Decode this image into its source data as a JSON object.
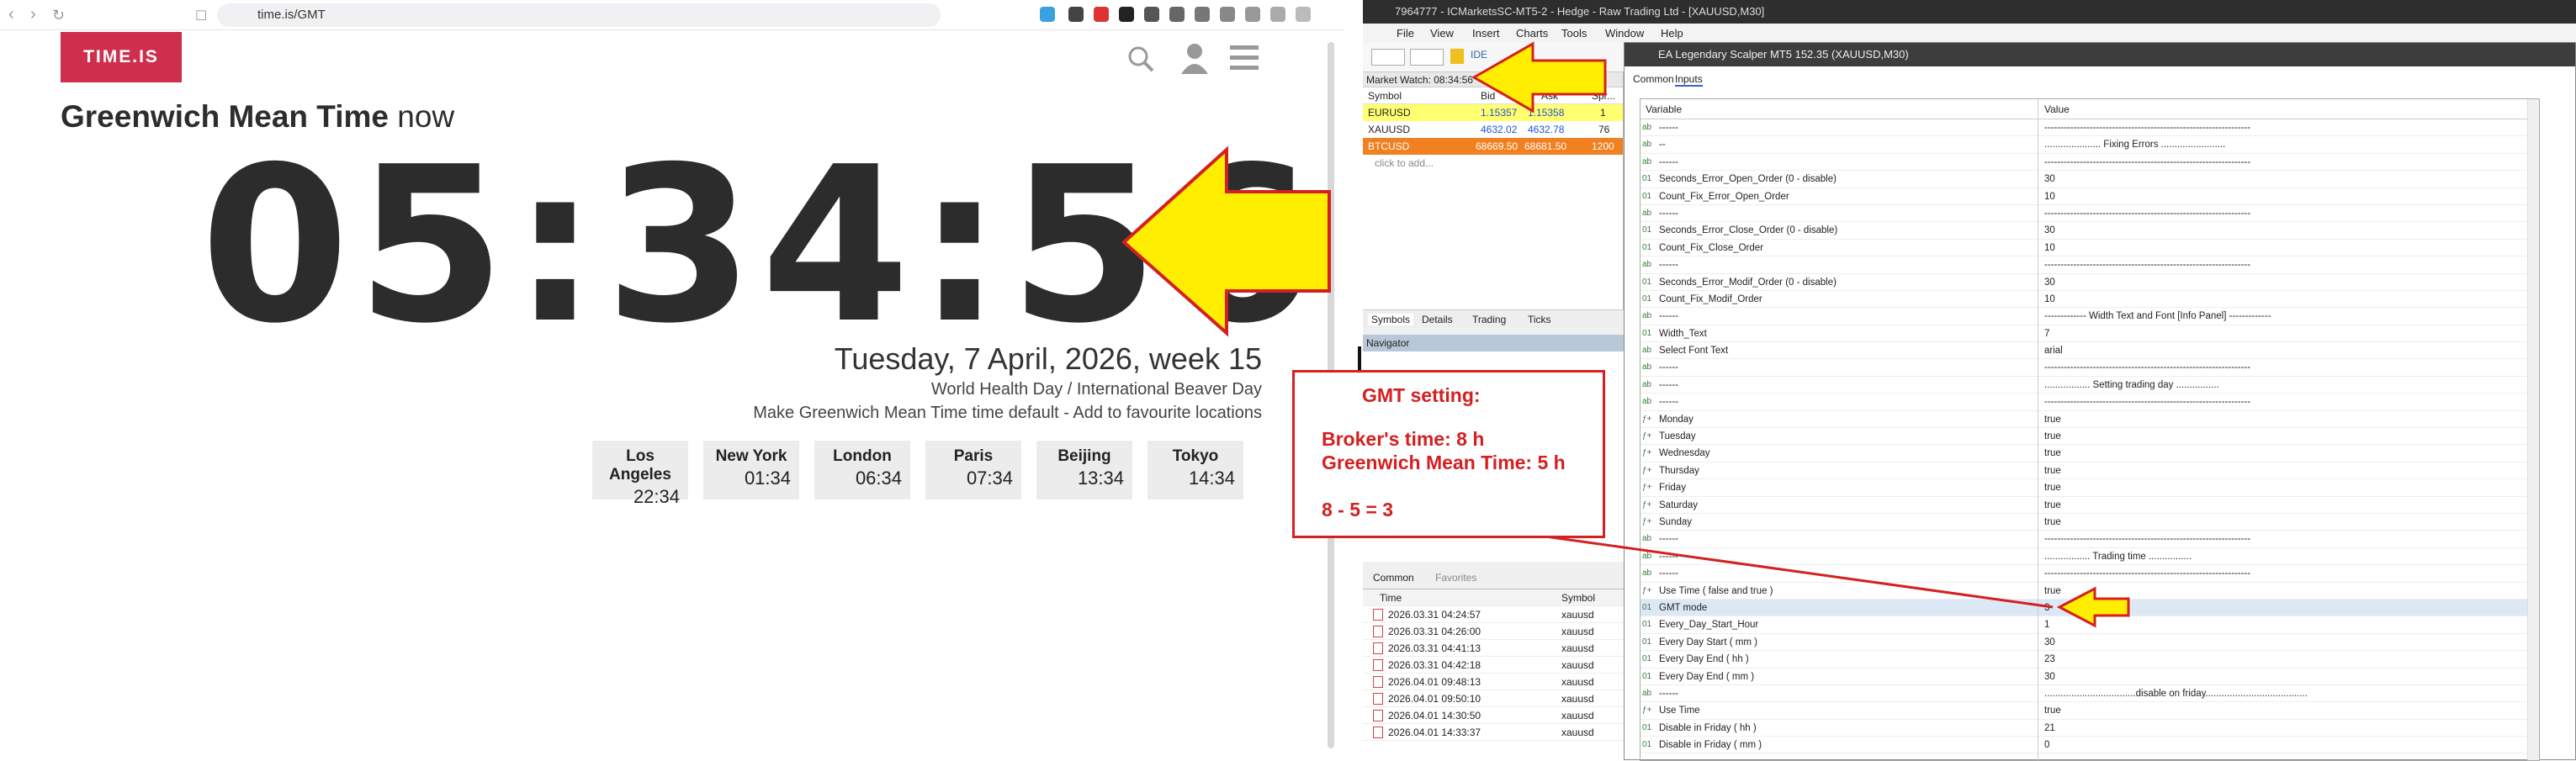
{
  "browser": {
    "url": "time.is/GMT",
    "logo": "TIME.IS",
    "title_bold": "Greenwich Mean Time",
    "title_light": " now",
    "clock": "05:34:56",
    "date": "Tuesday, 7 April, 2026, week 15",
    "holiday": "World Health Day / International Beaver Day",
    "make_default": "Make Greenwich Mean Time time default - Add to favourite locations",
    "cities": [
      {
        "name": "Los Angeles",
        "time": "22:34"
      },
      {
        "name": "New York",
        "time": "01:34"
      },
      {
        "name": "London",
        "time": "06:34"
      },
      {
        "name": "Paris",
        "time": "07:34"
      },
      {
        "name": "Beijing",
        "time": "13:34"
      },
      {
        "name": "Tokyo",
        "time": "14:34"
      }
    ]
  },
  "mt5": {
    "window_title": "7964777 - ICMarketsSC-MT5-2 - Hedge - Raw Trading Ltd - [XAUUSD,M30]",
    "menu": [
      "File",
      "View",
      "Insert",
      "Charts",
      "Tools",
      "Window",
      "Help"
    ],
    "market_watch": {
      "header": "Market Watch: 08:34:56",
      "columns": [
        "Symbol",
        "Bid",
        "Ask",
        "Spr..."
      ],
      "rows": [
        {
          "symbol": "EURUSD",
          "bid": "1.15357",
          "ask": "1.15358",
          "spread": "1"
        },
        {
          "symbol": "XAUUSD",
          "bid": "4632.02",
          "ask": "4632.78",
          "spread": "76"
        },
        {
          "symbol": "BTCUSD",
          "bid": "68669.50",
          "ask": "68681.50",
          "spread": "1200"
        }
      ],
      "add_label": "click to add...",
      "tabs": [
        "Symbols",
        "Details",
        "Trading",
        "Ticks"
      ]
    },
    "navigator": "Navigator",
    "bottom_tabs": [
      "Common",
      "Favorites"
    ],
    "history": {
      "columns": [
        "Time",
        "Symbol"
      ],
      "rows": [
        {
          "time": "2026.03.31 04:24:57",
          "symbol": "xauusd"
        },
        {
          "time": "2026.03.31 04:26:00",
          "symbol": "xauusd"
        },
        {
          "time": "2026.03.31 04:41:13",
          "symbol": "xauusd"
        },
        {
          "time": "2026.03.31 04:42:18",
          "symbol": "xauusd"
        },
        {
          "time": "2026.04.01 09:48:13",
          "symbol": "xauusd"
        },
        {
          "time": "2026.04.01 09:50:10",
          "symbol": "xauusd"
        },
        {
          "time": "2026.04.01 14:30:50",
          "symbol": "xauusd"
        },
        {
          "time": "2026.04.01 14:33:37",
          "symbol": "xauusd"
        }
      ]
    },
    "dialog": {
      "title": "EA Legendary Scalper MT5 152.35 (XAUUSD,M30)",
      "tabs": [
        "Common",
        "Inputs"
      ],
      "col_variable": "Variable",
      "col_value": "Value",
      "rows": [
        {
          "icon": "ab",
          "name": "------",
          "value": "----------------------------------------------------------------"
        },
        {
          "icon": "ab",
          "name": "--",
          "value": "..................... Fixing Errors ........................"
        },
        {
          "icon": "ab",
          "name": "------",
          "value": "----------------------------------------------------------------"
        },
        {
          "icon": "01",
          "name": "Seconds_Error_Open_Order (0 - disable)",
          "value": "30"
        },
        {
          "icon": "01",
          "name": "Count_Fix_Error_Open_Order",
          "value": "10"
        },
        {
          "icon": "ab",
          "name": "------",
          "value": "----------------------------------------------------------------"
        },
        {
          "icon": "01",
          "name": "Seconds_Error_Close_Order (0 - disable)",
          "value": "30"
        },
        {
          "icon": "01",
          "name": "Count_Fix_Close_Order",
          "value": "10"
        },
        {
          "icon": "ab",
          "name": "------",
          "value": "----------------------------------------------------------------"
        },
        {
          "icon": "01",
          "name": "Seconds_Error_Modif_Order (0 - disable)",
          "value": "30"
        },
        {
          "icon": "01",
          "name": "Count_Fix_Modif_Order",
          "value": "10"
        },
        {
          "icon": "ab",
          "name": "------",
          "value": "------------- Width Text and Font [Info Panel] -------------"
        },
        {
          "icon": "01",
          "name": "Width_Text",
          "value": "7"
        },
        {
          "icon": "ab",
          "name": "Select Font Text",
          "value": "arial"
        },
        {
          "icon": "ab",
          "name": "------",
          "value": "----------------------------------------------------------------"
        },
        {
          "icon": "ab",
          "name": "------",
          "value": "................. Setting trading day ................"
        },
        {
          "icon": "ab",
          "name": "------",
          "value": "----------------------------------------------------------------"
        },
        {
          "icon": "tf",
          "name": "Monday",
          "value": "true"
        },
        {
          "icon": "tf",
          "name": "Tuesday",
          "value": "true"
        },
        {
          "icon": "tf",
          "name": "Wednesday",
          "value": "true"
        },
        {
          "icon": "tf",
          "name": "Thursday",
          "value": "true"
        },
        {
          "icon": "tf",
          "name": "Friday",
          "value": "true"
        },
        {
          "icon": "tf",
          "name": "Saturday",
          "value": "true"
        },
        {
          "icon": "tf",
          "name": "Sunday",
          "value": "true"
        },
        {
          "icon": "ab",
          "name": "------",
          "value": "----------------------------------------------------------------"
        },
        {
          "icon": "ab",
          "name": "------",
          "value": "................. Trading time ................"
        },
        {
          "icon": "ab",
          "name": "------",
          "value": "----------------------------------------------------------------"
        },
        {
          "icon": "tf",
          "name": "Use Time ( false and true )",
          "value": "true"
        },
        {
          "icon": "01",
          "name": "GMT mode",
          "value": "3"
        },
        {
          "icon": "01",
          "name": "Every_Day_Start_Hour",
          "value": "1"
        },
        {
          "icon": "01",
          "name": "Every Day Start ( mm )",
          "value": "30"
        },
        {
          "icon": "01",
          "name": "Every Day End ( hh )",
          "value": "23"
        },
        {
          "icon": "01",
          "name": "Every Day End ( mm )",
          "value": "30"
        },
        {
          "icon": "ab",
          "name": "------",
          "value": "..................................disable on friday......................................"
        },
        {
          "icon": "tf",
          "name": "Use Time",
          "value": "true"
        },
        {
          "icon": "01",
          "name": "Disable in Friday ( hh )",
          "value": "21"
        },
        {
          "icon": "01",
          "name": "Disable in Friday ( mm )",
          "value": "0"
        }
      ]
    }
  },
  "annotation": {
    "heading": "GMT setting:",
    "line1": "Broker's time: 8 h",
    "line2": "Greenwich Mean Time: 5 h",
    "line3": "8 - 5 = 3",
    "color": "#d42020",
    "arrow_color": "#ffee00"
  }
}
